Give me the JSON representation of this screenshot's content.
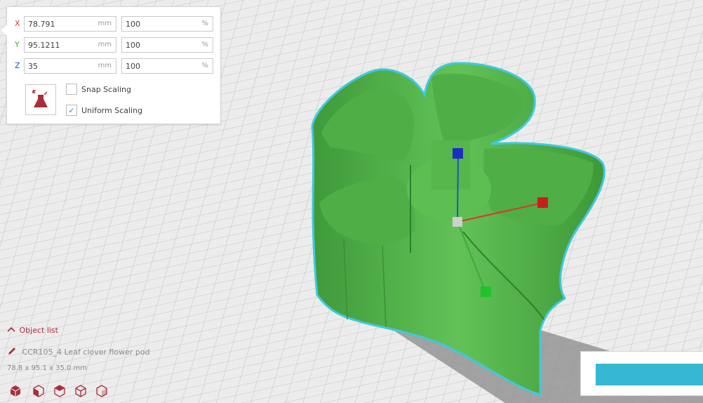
{
  "scale_panel": {
    "x": {
      "label": "X",
      "size": "78.791",
      "size_unit": "mm",
      "percent": "100",
      "percent_unit": "%"
    },
    "y": {
      "label": "Y",
      "size": "95.1211",
      "size_unit": "mm",
      "percent": "100",
      "percent_unit": "%"
    },
    "z": {
      "label": "Z",
      "size": "35",
      "size_unit": "mm",
      "percent": "100",
      "percent_unit": "%"
    },
    "lock_icon": "scale-lock-icon",
    "snap_scaling": {
      "label": "Snap Scaling",
      "checked": false
    },
    "uniform_scaling": {
      "label": "Uniform Scaling",
      "checked": true,
      "check_mark": "✓"
    }
  },
  "object_list": {
    "toggle_label": "Object list",
    "object_name": "CCR105_4 Leaf clover flower pod",
    "dimensions": "78.8 x 95.1 x 35.0 mm",
    "view_buttons": [
      "3d-view-icon",
      "front-view-icon",
      "top-view-icon",
      "left-view-icon",
      "right-view-icon"
    ]
  },
  "colors": {
    "model": "#55b34a",
    "outline": "#3fc8e0",
    "axis_x": "#d9362e",
    "axis_y": "#3faa3a",
    "axis_z": "#2457a8",
    "accent": "#a92e3c",
    "action_button": "#35b8d3"
  }
}
